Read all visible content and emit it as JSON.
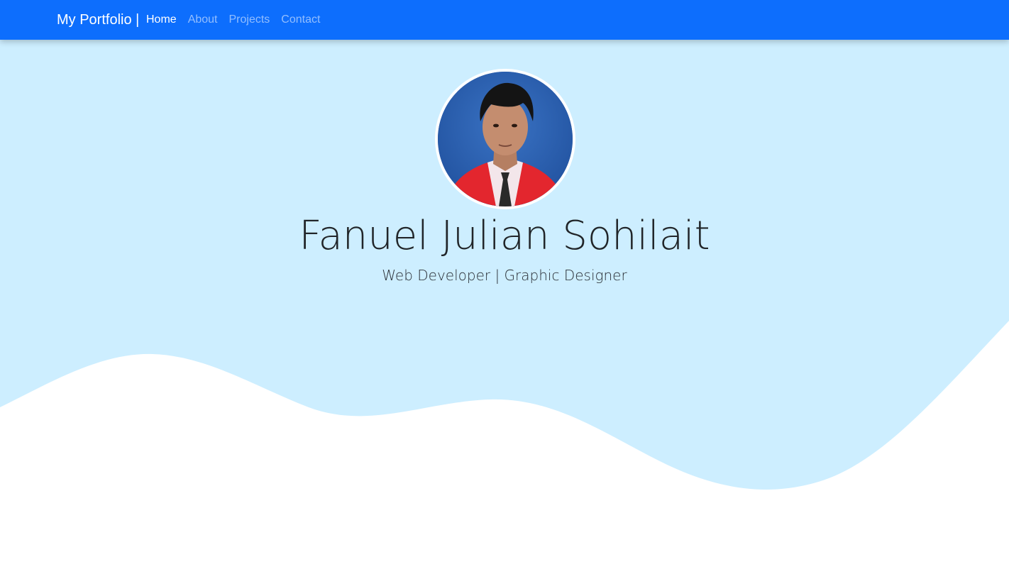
{
  "navbar": {
    "brand": "My Portfolio |",
    "links": [
      {
        "label": "Home",
        "active": true
      },
      {
        "label": "About",
        "active": false
      },
      {
        "label": "Projects",
        "active": false
      },
      {
        "label": "Contact",
        "active": false
      }
    ]
  },
  "hero": {
    "name": "Fanuel Julian Sohilait",
    "subtitle": "Web Developer | Graphic Designer"
  },
  "colors": {
    "navbar_bg": "#0d6efd",
    "hero_bg": "#cdeeff",
    "wave_fill": "#ffffff"
  },
  "icons": {
    "avatar": "profile-photo"
  }
}
